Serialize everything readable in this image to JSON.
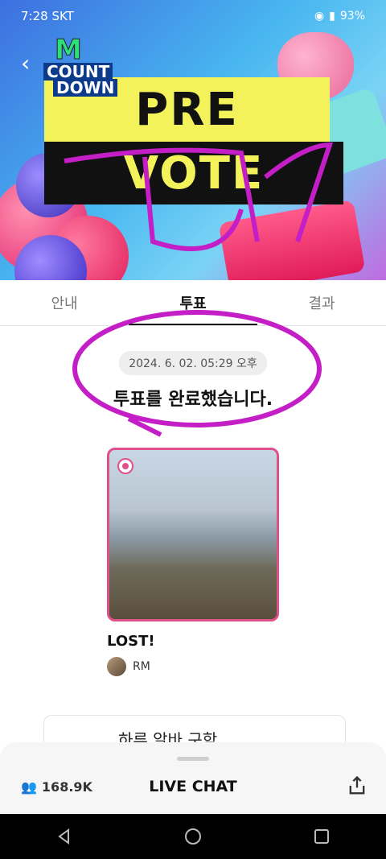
{
  "status_bar": {
    "time": "7:28 SKT",
    "battery": "93%"
  },
  "banner": {
    "logo_m": "M",
    "logo_line1": "COUNT",
    "logo_line2": "DOWN",
    "pre": "PRE",
    "vote": "VOTE"
  },
  "tabs": [
    {
      "label": "안내"
    },
    {
      "label": "투표"
    },
    {
      "label": "결과"
    }
  ],
  "vote": {
    "date": "2024. 6. 02. 05:29 오후",
    "message": "투표를 완료했습니다."
  },
  "candidate": {
    "song": "LOST!",
    "artist": "RM"
  },
  "next_card": {
    "label": "하루 알바 구함"
  },
  "chat": {
    "viewers": "168.9K",
    "title": "LIVE CHAT"
  },
  "colors": {
    "accent": "#e0508a",
    "banner_yellow": "#f3f25a"
  }
}
